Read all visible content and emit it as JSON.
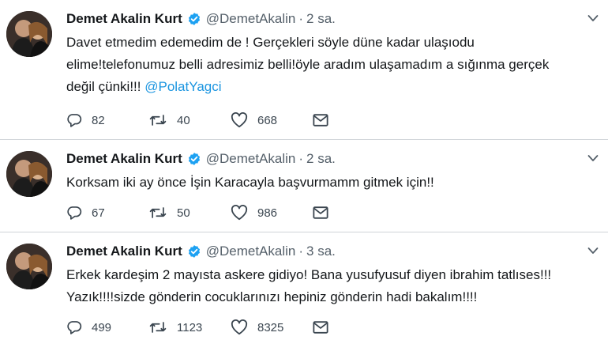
{
  "tweets": [
    {
      "name": "Demet Akalin Kurt",
      "handle": "@DemetAkalin",
      "separator": "·",
      "time": "2 sa.",
      "text_lines": [
        "Davet etmedim edemedim de ! Gerçekleri söyle düne kadar ulaşıodu",
        "elime!telefonumuz belli adresimiz belli!öyle aradım ulaşamadım a sığınma gerçek",
        "değil çünki!!! "
      ],
      "mention": "@PolatYagci",
      "replies": "82",
      "retweets": "40",
      "likes": "668"
    },
    {
      "name": "Demet Akalin Kurt",
      "handle": "@DemetAkalin",
      "separator": "·",
      "time": "2 sa.",
      "text_lines": [
        "Korksam iki ay önce İşin Karacayla başvurmamm gitmek için!!"
      ],
      "replies": "67",
      "retweets": "50",
      "likes": "986"
    },
    {
      "name": "Demet Akalin Kurt",
      "handle": "@DemetAkalin",
      "separator": "·",
      "time": "3 sa.",
      "text_lines": [
        "Erkek kardeşim 2 mayısta askere gidiyo! Bana yusufyusuf diyen ibrahim tatlıses!!!",
        "Yazık!!!!sizde gönderin cocuklarınızı hepiniz gönderin hadi bakalım!!!!"
      ],
      "replies": "499",
      "retweets": "1123",
      "likes": "8325"
    }
  ],
  "icons": {
    "verified": "verified-badge-icon",
    "reply": "reply-icon",
    "retweet": "retweet-icon",
    "like": "heart-icon",
    "dm": "envelope-icon",
    "more": "chevron-down-icon"
  },
  "colors": {
    "link": "#1b95e0",
    "verified": "#1da1f2",
    "muted": "#55606a"
  }
}
